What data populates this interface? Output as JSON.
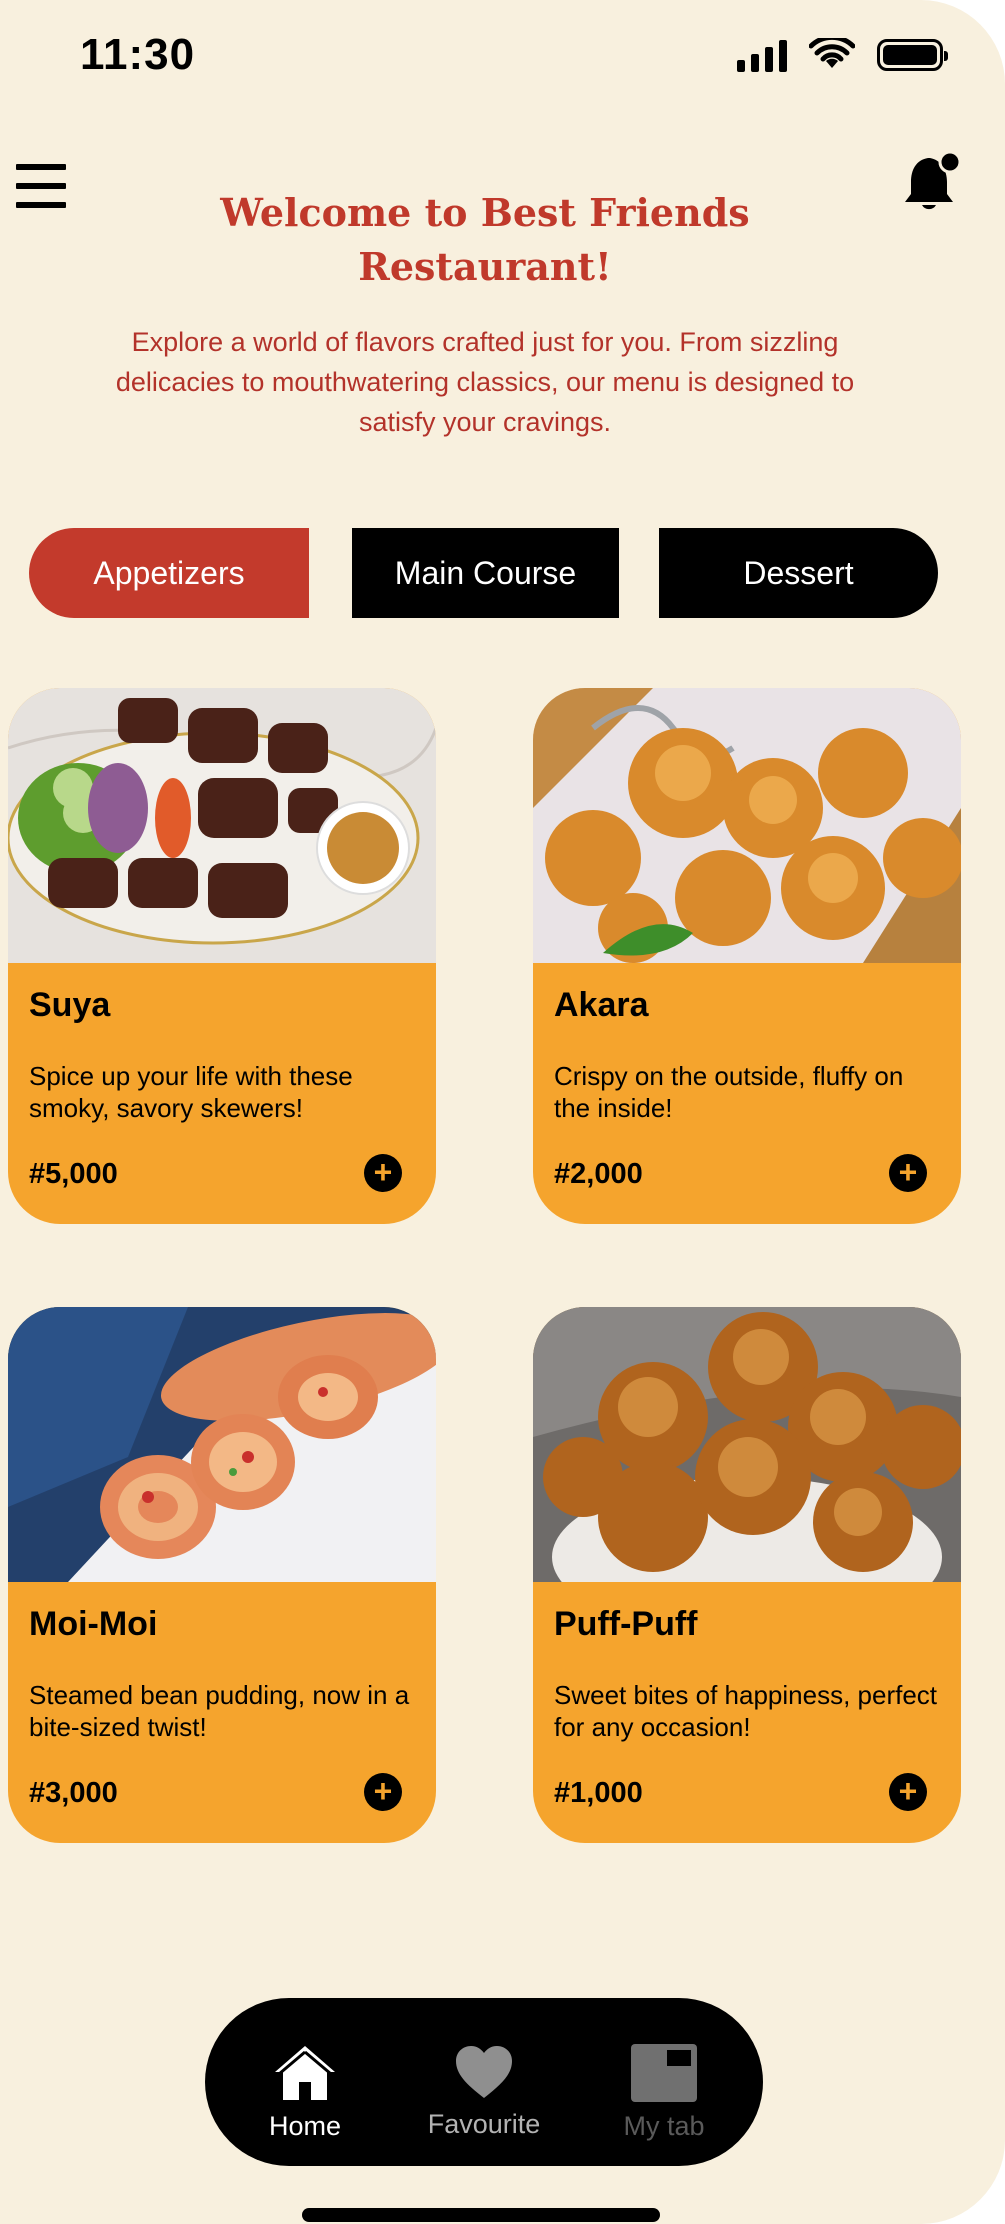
{
  "status_bar": {
    "time": "11:30",
    "icons": [
      "signal-icon",
      "wifi-icon",
      "battery-icon"
    ]
  },
  "header": {
    "menu_icon": "hamburger-menu-icon",
    "notification_icon": "bell-icon",
    "title": "Welcome to Best Friends Restaurant!",
    "intro": "Explore a world of flavors crafted just for you. From sizzling delicacies to mouthwatering classics, our menu is designed to satisfy your cravings."
  },
  "tabs": [
    {
      "label": "Appetizers",
      "active": true
    },
    {
      "label": "Main Course",
      "active": false
    },
    {
      "label": "Dessert",
      "active": false
    }
  ],
  "menu_items": [
    {
      "name": "Suya",
      "description": "Spice up your life with these smoky, savory skewers!",
      "price": "#5,000",
      "image": "suya-photo"
    },
    {
      "name": "Akara",
      "description": "Crispy on the outside, fluffy on the inside!",
      "price": "#2,000",
      "image": "akara-photo"
    },
    {
      "name": "Moi-Moi",
      "description": "Steamed bean pudding, now in a bite-sized twist!",
      "price": "#3,000",
      "image": "moi-moi-photo"
    },
    {
      "name": "Puff-Puff",
      "description": "Sweet bites of happiness, perfect for any occasion!",
      "price": "#1,000",
      "image": "puff-puff-photo"
    }
  ],
  "bottom_nav": [
    {
      "label": "Home",
      "icon": "home-icon",
      "active": true
    },
    {
      "label": "Favourite",
      "icon": "heart-icon",
      "active": false
    },
    {
      "label": "My tab",
      "icon": "tab-icon",
      "active": false
    }
  ],
  "colors": {
    "background": "#F8F0DE",
    "accent_red": "#C33A2C",
    "card_orange": "#F5A42D",
    "black": "#000000"
  }
}
